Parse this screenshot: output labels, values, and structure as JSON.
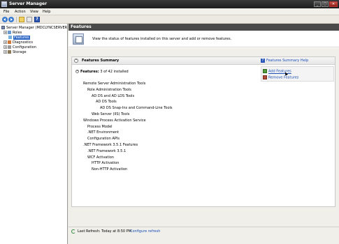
{
  "window": {
    "title": "Server Manager",
    "min": "_",
    "max": "□",
    "close": "✕"
  },
  "menu": [
    "File",
    "Action",
    "View",
    "Help"
  ],
  "tree": {
    "root": "Server Manager (MDCLYNCSERVER",
    "items": [
      "Roles",
      "Features",
      "Diagnostics",
      "Configuration",
      "Storage"
    ],
    "selected": "Features"
  },
  "pane": {
    "title": "Features",
    "intro": "View the status of features installed on this server and add or remove features."
  },
  "summary": {
    "title": "Features Summary",
    "help_link": "Features Summary Help",
    "features_label": "Features:",
    "installed": "3 of 42 installed",
    "actions": [
      "Add Features",
      "Remove Features"
    ]
  },
  "features": [
    {
      "label": "Remote Server Administration Tools",
      "level": 0
    },
    {
      "label": "Role Administration Tools",
      "level": 1
    },
    {
      "label": "AD DS and AD LDS Tools",
      "level": 2
    },
    {
      "label": "AD DS Tools",
      "level": 3
    },
    {
      "label": "AD DS Snap-Ins and Command-Line Tools",
      "level": 4
    },
    {
      "label": "Web Server (IIS) Tools",
      "level": 2
    },
    {
      "label": "Windows Process Activation Service",
      "level": 0
    },
    {
      "label": "Process Model",
      "level": 1
    },
    {
      "label": ".NET Environment",
      "level": 1
    },
    {
      "label": "Configuration APIs",
      "level": 1
    },
    {
      "label": ".NET Framework 3.5.1 Features",
      "level": 0
    },
    {
      "label": ".NET Framework 3.5.1",
      "level": 1
    },
    {
      "label": "WCF Activation",
      "level": 1
    },
    {
      "label": "HTTP Activation",
      "level": 2
    },
    {
      "label": "Non-HTTP Activation",
      "level": 2
    }
  ],
  "status": {
    "last_refresh": "Last Refresh: Today at 8:50 PM",
    "configure_link": "Configure refresh"
  }
}
